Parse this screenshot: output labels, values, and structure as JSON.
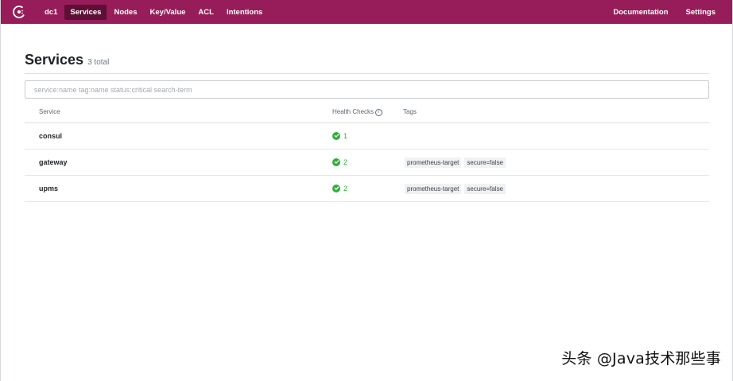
{
  "nav": {
    "datacenter": "dc1",
    "left_items": [
      "Services",
      "Nodes",
      "Key/Value",
      "ACL",
      "Intentions"
    ],
    "active_item": "Services",
    "right_items": [
      "Documentation",
      "Settings"
    ],
    "brand_color": "#961d59",
    "active_color": "#5e0f35"
  },
  "page": {
    "title": "Services",
    "total": "3 total"
  },
  "search": {
    "value": "",
    "placeholder": "service:name tag:name status:critical search-term"
  },
  "table": {
    "headers": {
      "service": "Service",
      "health": "Health Checks",
      "tags": "Tags"
    },
    "rows": [
      {
        "name": "consul",
        "health_count": "1",
        "tags": []
      },
      {
        "name": "gateway",
        "health_count": "2",
        "tags": [
          "prometheus-target",
          "secure=false"
        ]
      },
      {
        "name": "upms",
        "health_count": "2",
        "tags": [
          "prometheus-target",
          "secure=false"
        ]
      }
    ],
    "health_color": "#2eb039"
  },
  "watermark": "头条 @Java技术那些事"
}
